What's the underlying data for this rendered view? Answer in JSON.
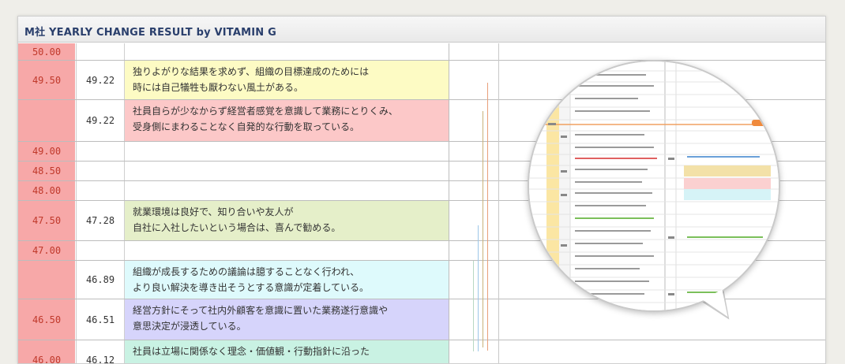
{
  "window": {
    "title": "M社 YEARLY CHANGE RESULT by VITAMIN G"
  },
  "rows": [
    {
      "score": "50.00",
      "avg": "",
      "text": "",
      "color": ""
    },
    {
      "score": "49.50",
      "avg": "49.22",
      "text": "独りよがりな結果を求めず、組織の目標達成のためには\n時には自己犠牲も厭わない風土がある。",
      "color": "#fdfbc4"
    },
    {
      "score": "",
      "avg": "49.22",
      "text": "社員自らが少なからず経営者感覚を意識して業務にとりくみ、\n受身側にまわることなく自発的な行動を取っている。",
      "color": "#fcc8c8"
    },
    {
      "score": "49.00",
      "avg": "",
      "text": "",
      "color": ""
    },
    {
      "score": "48.50",
      "avg": "",
      "text": "",
      "color": ""
    },
    {
      "score": "48.00",
      "avg": "",
      "text": "",
      "color": ""
    },
    {
      "score": "47.50",
      "avg": "47.28",
      "text": "就業環境は良好で、知り合いや友人が\n自社に入社したいという場合は、喜んで勧める。",
      "color": "#e5efc9"
    },
    {
      "score": "47.00",
      "avg": "",
      "text": "",
      "color": ""
    },
    {
      "score": "",
      "avg": "46.89",
      "text": "組織が成長するための議論は臆することなく行われ、\nより良い解決を導き出そうとする意識が定着している。",
      "color": "#defafc"
    },
    {
      "score": "46.50",
      "avg": "46.51",
      "text": "経営方針にそって社内外顧客を意識に置いた業務遂行意識や\n意思決定が浸透している。",
      "color": "#d6d4fb"
    },
    {
      "score": "46.00",
      "avg": "46.12",
      "text": "社員は立場に関係なく理念・価値観・行動指針に沿った",
      "color": "#c9f2e3"
    }
  ],
  "colors": {
    "score_bg": "#f7a8a8",
    "score_text": "#c0392b",
    "title_text": "#2a3f6c",
    "connector_a": "#e8a07a",
    "connector_b": "#9ec7e8",
    "connector_c": "#c9b27a"
  }
}
